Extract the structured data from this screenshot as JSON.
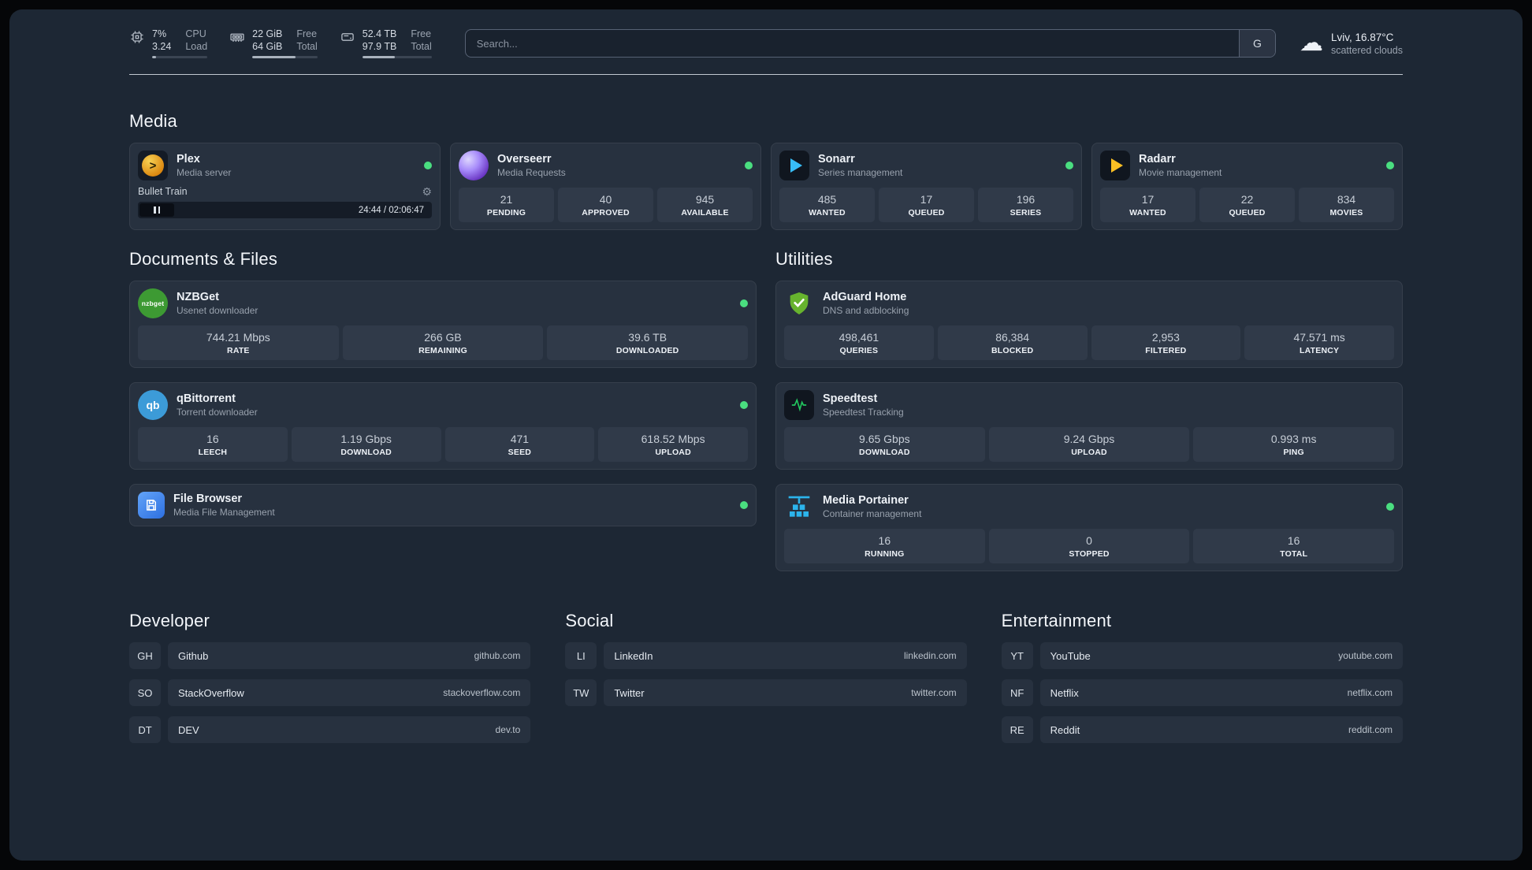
{
  "topbar": {
    "resources": [
      {
        "icon": "cpu-icon",
        "value1": "7%",
        "value2": "3.24",
        "label1": "CPU",
        "label2": "Load",
        "bar_percent": 7
      },
      {
        "icon": "memory-icon",
        "value1": "22 GiB",
        "value2": "64 GiB",
        "label1": "Free",
        "label2": "Total",
        "bar_percent": 66
      },
      {
        "icon": "disk-icon",
        "value1": "52.4 TB",
        "value2": "97.9 TB",
        "label1": "Free",
        "label2": "Total",
        "bar_percent": 47
      }
    ],
    "search": {
      "placeholder": "Search...",
      "provider_label": "G"
    },
    "weather": {
      "icon": "cloud-icon",
      "location": "Lviv, 16.87°C",
      "condition": "scattered clouds"
    }
  },
  "sections": {
    "media": {
      "title": "Media",
      "plex": {
        "icon": "plex-icon",
        "name": "Plex",
        "subtitle": "Media server",
        "now_playing": "Bullet Train",
        "time": "24:44 / 02:06:47"
      },
      "cards": [
        {
          "icon": "overseerr-icon",
          "name": "Overseerr",
          "subtitle": "Media Requests",
          "stats": [
            {
              "value": "21",
              "label": "PENDING"
            },
            {
              "value": "40",
              "label": "APPROVED"
            },
            {
              "value": "945",
              "label": "AVAILABLE"
            }
          ]
        },
        {
          "icon": "sonarr-icon",
          "name": "Sonarr",
          "subtitle": "Series management",
          "stats": [
            {
              "value": "485",
              "label": "WANTED"
            },
            {
              "value": "17",
              "label": "QUEUED"
            },
            {
              "value": "196",
              "label": "SERIES"
            }
          ]
        },
        {
          "icon": "radarr-icon",
          "name": "Radarr",
          "subtitle": "Movie management",
          "stats": [
            {
              "value": "17",
              "label": "WANTED"
            },
            {
              "value": "22",
              "label": "QUEUED"
            },
            {
              "value": "834",
              "label": "MOVIES"
            }
          ]
        }
      ]
    },
    "documents": {
      "title": "Documents & Files",
      "cards": [
        {
          "icon": "nzbget-icon",
          "name": "NZBGet",
          "subtitle": "Usenet downloader",
          "stats": [
            {
              "value": "744.21 Mbps",
              "label": "RATE"
            },
            {
              "value": "266 GB",
              "label": "REMAINING"
            },
            {
              "value": "39.6 TB",
              "label": "DOWNLOADED"
            }
          ]
        },
        {
          "icon": "qbittorrent-icon",
          "name": "qBittorrent",
          "subtitle": "Torrent downloader",
          "stats": [
            {
              "value": "16",
              "label": "LEECH"
            },
            {
              "value": "1.19 Gbps",
              "label": "DOWNLOAD"
            },
            {
              "value": "471",
              "label": "SEED"
            },
            {
              "value": "618.52 Mbps",
              "label": "UPLOAD"
            }
          ]
        },
        {
          "icon": "filebrowser-icon",
          "name": "File Browser",
          "subtitle": "Media File Management"
        }
      ]
    },
    "utilities": {
      "title": "Utilities",
      "cards": [
        {
          "icon": "adguard-icon",
          "name": "AdGuard Home",
          "subtitle": "DNS and adblocking",
          "stats": [
            {
              "value": "498,461",
              "label": "QUERIES"
            },
            {
              "value": "86,384",
              "label": "BLOCKED"
            },
            {
              "value": "2,953",
              "label": "FILTERED"
            },
            {
              "value": "47.571 ms",
              "label": "LATENCY"
            }
          ]
        },
        {
          "icon": "speedtest-icon",
          "name": "Speedtest",
          "subtitle": "Speedtest Tracking",
          "stats": [
            {
              "value": "9.65 Gbps",
              "label": "DOWNLOAD"
            },
            {
              "value": "9.24 Gbps",
              "label": "UPLOAD"
            },
            {
              "value": "0.993 ms",
              "label": "PING"
            }
          ]
        },
        {
          "icon": "portainer-icon",
          "name": "Media Portainer",
          "subtitle": "Container management",
          "stats": [
            {
              "value": "16",
              "label": "RUNNING"
            },
            {
              "value": "0",
              "label": "STOPPED"
            },
            {
              "value": "16",
              "label": "TOTAL"
            }
          ]
        }
      ]
    },
    "bookmarks": [
      {
        "title": "Developer",
        "links": [
          {
            "abbr": "GH",
            "name": "Github",
            "url": "github.com"
          },
          {
            "abbr": "SO",
            "name": "StackOverflow",
            "url": "stackoverflow.com"
          },
          {
            "abbr": "DT",
            "name": "DEV",
            "url": "dev.to"
          }
        ]
      },
      {
        "title": "Social",
        "links": [
          {
            "abbr": "LI",
            "name": "LinkedIn",
            "url": "linkedin.com"
          },
          {
            "abbr": "TW",
            "name": "Twitter",
            "url": "twitter.com"
          }
        ]
      },
      {
        "title": "Entertainment",
        "links": [
          {
            "abbr": "YT",
            "name": "YouTube",
            "url": "youtube.com"
          },
          {
            "abbr": "NF",
            "name": "Netflix",
            "url": "netflix.com"
          },
          {
            "abbr": "RE",
            "name": "Reddit",
            "url": "reddit.com"
          }
        ]
      }
    ]
  },
  "icons": {
    "nzbget_label": "nzbget",
    "qbittorrent_label": "qb",
    "plex_glyph": ">",
    "gear_glyph": "⚙",
    "cloud_glyph": "☁"
  },
  "colors": {
    "status_online": "#4ade80",
    "accent_green": "#22c55e"
  }
}
